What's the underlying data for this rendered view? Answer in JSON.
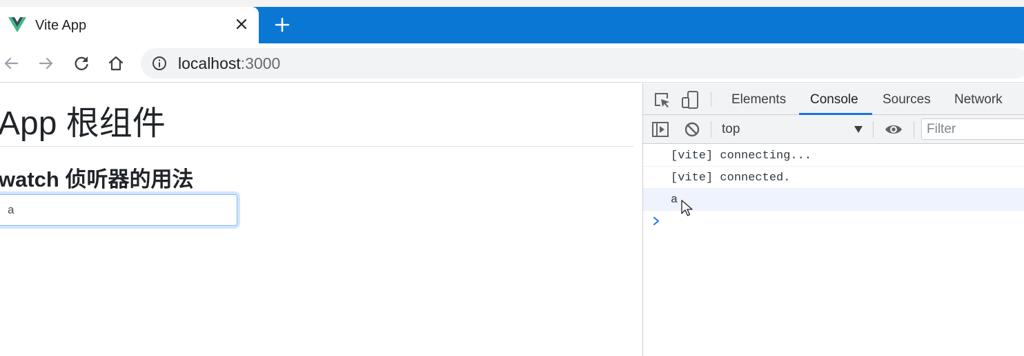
{
  "browser": {
    "tab": {
      "title": "Vite App",
      "favicon": "vue-logo-icon"
    },
    "address": {
      "host": "localhost",
      "port": ":3000"
    },
    "colors": {
      "tab_bar": "#0a77d5",
      "vue_green": "#41b883",
      "vue_dark": "#35495e"
    }
  },
  "page": {
    "title": "App 根组件",
    "subtitle": "watch 侦听器的用法",
    "input_value": "a"
  },
  "devtools": {
    "tabs": [
      "Elements",
      "Console",
      "Sources",
      "Network"
    ],
    "active_tab": "Console",
    "context": "top",
    "filter_placeholder": "Filter",
    "messages": [
      "[vite] connecting...",
      "[vite] connected.",
      "a"
    ]
  }
}
